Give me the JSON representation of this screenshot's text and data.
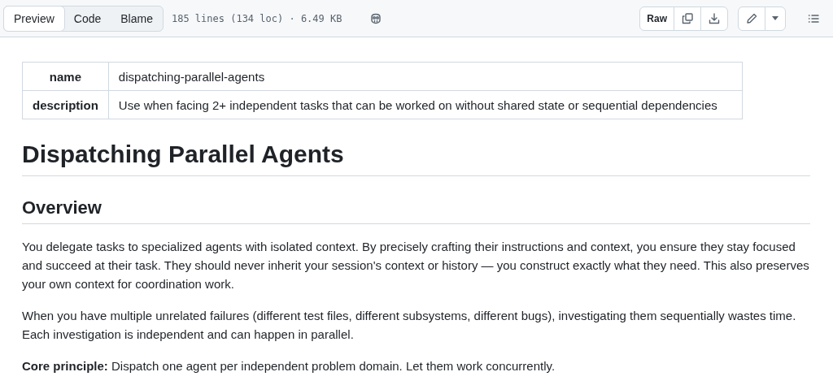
{
  "toolbar": {
    "tabs": [
      {
        "label": "Preview",
        "selected": true
      },
      {
        "label": "Code",
        "selected": false
      },
      {
        "label": "Blame",
        "selected": false
      }
    ],
    "file_info": "185 lines (134 loc) · 6.49 KB",
    "raw_label": "Raw"
  },
  "front_matter": [
    {
      "key": "name",
      "value": "dispatching-parallel-agents"
    },
    {
      "key": "description",
      "value": "Use when facing 2+ independent tasks that can be worked on without shared state or sequential dependencies"
    }
  ],
  "title": "Dispatching Parallel Agents",
  "section": {
    "heading": "Overview",
    "paragraphs": [
      "You delegate tasks to specialized agents with isolated context. By precisely crafting their instructions and context, you ensure they stay focused and succeed at their task. They should never inherit your session's context or history — you construct exactly what they need. This also preserves your own context for coordination work.",
      "When you have multiple unrelated failures (different test files, different subsystems, different bugs), investigating them sequentially wastes time. Each investigation is independent and can happen in parallel.",
      "**Core principle:** Dispatch one agent per independent problem domain. Let them work concurrently."
    ]
  }
}
